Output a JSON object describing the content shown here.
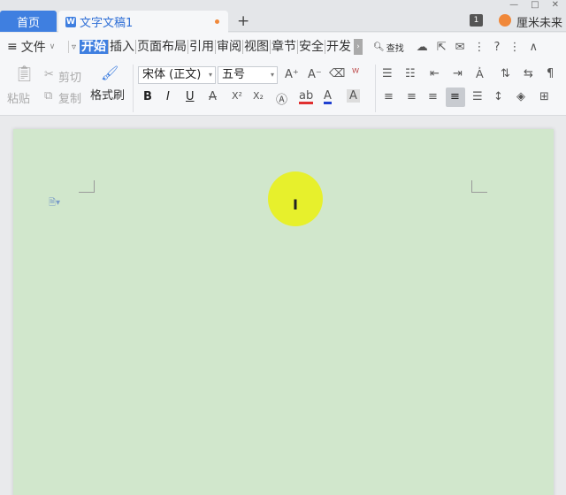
{
  "tabs": {
    "home": "首页",
    "doc": "文字文稿1",
    "add": "+"
  },
  "topright": {
    "badge": "1",
    "user": "厘米未来"
  },
  "window": {
    "minimize": "—",
    "maximize": "□",
    "close": "✕"
  },
  "menu": {
    "file": "文件",
    "tabs": [
      "开始",
      "插入",
      "页面布局",
      "引用",
      "审阅",
      "视图",
      "章节",
      "安全",
      "开发"
    ],
    "more": "›",
    "search": "查找"
  },
  "ribbon": {
    "paste": "粘贴",
    "cut": "剪切",
    "copy": "复制",
    "format_painter": "格式刷",
    "font_name": "宋体 (正文)",
    "font_size": "五号",
    "bold": "B",
    "italic": "I",
    "underline": "U",
    "strike": "A",
    "superscript": "X²",
    "subscript": "X₂",
    "font_color": "A",
    "grow": "A⁺",
    "shrink": "A⁻"
  },
  "colors": {
    "accent": "#3f7fe0",
    "page_bg": "#d1e7cc",
    "cursor_highlight": "#e8f023"
  }
}
